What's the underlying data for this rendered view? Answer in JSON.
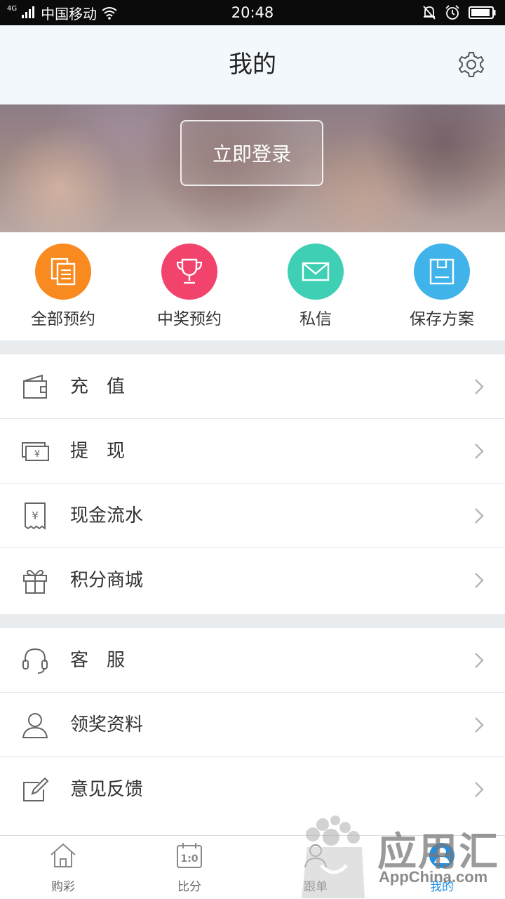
{
  "status_bar": {
    "network_type": "4G",
    "carrier": "中国移动",
    "time": "20:48",
    "icons": [
      "signal-icon",
      "wifi-icon",
      "mute-icon",
      "alarm-icon",
      "battery-icon"
    ]
  },
  "header": {
    "title": "我的",
    "settings_icon": "gear-icon"
  },
  "banner": {
    "login_label": "立即登录"
  },
  "shortcuts": [
    {
      "label": "全部预约",
      "icon": "documents-icon",
      "color": "#f98a1f"
    },
    {
      "label": "中奖预约",
      "icon": "trophy-icon",
      "color": "#f2436c"
    },
    {
      "label": "私信",
      "icon": "envelope-icon",
      "color": "#3fcfb4"
    },
    {
      "label": "保存方案",
      "icon": "save-icon",
      "color": "#3fb3ea"
    }
  ],
  "menu_group_1": [
    {
      "label": "充　值",
      "icon": "wallet-icon"
    },
    {
      "label": "提　现",
      "icon": "cash-icon"
    },
    {
      "label": "现金流水",
      "icon": "receipt-icon"
    },
    {
      "label": "积分商城",
      "icon": "gift-icon"
    }
  ],
  "menu_group_2": [
    {
      "label": "客　服",
      "icon": "headset-icon"
    },
    {
      "label": "领奖资料",
      "icon": "user-icon"
    },
    {
      "label": "意见反馈",
      "icon": "edit-icon"
    }
  ],
  "bottom_nav": [
    {
      "label": "购彩",
      "icon": "home-icon",
      "active": false
    },
    {
      "label": "比分",
      "icon": "calendar-score-icon",
      "active": false
    },
    {
      "label": "跟单",
      "icon": "follow-icon",
      "active": false
    },
    {
      "label": "我的",
      "icon": "user-icon",
      "active": true
    }
  ],
  "watermark": {
    "cn": "应用汇",
    "en": "AppChina.com"
  },
  "colors": {
    "accent": "#1e90e6",
    "header_bg": "#f3f8fc",
    "separator": "#e9ecef"
  }
}
